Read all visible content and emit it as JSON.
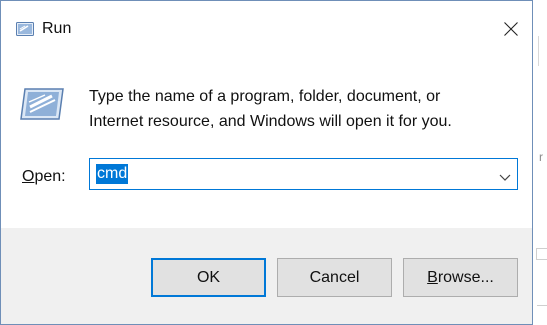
{
  "window": {
    "title": "Run",
    "icon": "run-icon",
    "close_icon": "close-icon"
  },
  "description": {
    "line1": "Type the name of a program, folder, document, or",
    "line2": "Internet resource, and Windows will open it for you."
  },
  "open_field": {
    "label_mnemonic": "O",
    "label_rest": "pen:",
    "value": "cmd",
    "dropdown_icon": "chevron-down-icon"
  },
  "buttons": {
    "ok": "OK",
    "cancel": "Cancel",
    "browse_mnemonic": "B",
    "browse_rest": "rowse..."
  },
  "colors": {
    "accent": "#0078d7",
    "footer_bg": "#f0f0f0",
    "button_bg": "#e1e1e1"
  }
}
